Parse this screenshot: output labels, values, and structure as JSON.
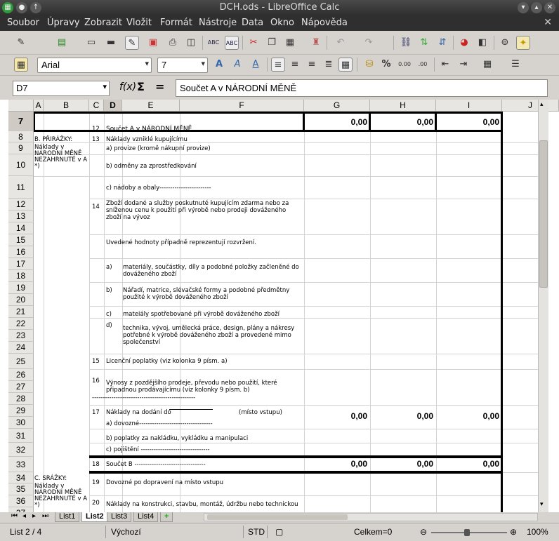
{
  "window": {
    "title": "DCH.ods - LibreOffice Calc"
  },
  "menu": [
    "Soubor",
    "Úpravy",
    "Zobrazit",
    "Vložit",
    "Formát",
    "Nástroje",
    "Data",
    "Okno",
    "Nápověda"
  ],
  "font": {
    "name": "Arial",
    "size": "7"
  },
  "cell_ref": "D7",
  "formula": "Součet A v NÁRODNÍ MĚNĚ",
  "columns": [
    "A",
    "B",
    "C",
    "D",
    "E",
    "F",
    "G",
    "H",
    "I",
    "J"
  ],
  "rows": [
    "7",
    "8",
    "9",
    "10",
    "11",
    "12",
    "13",
    "14",
    "15",
    "16",
    "17",
    "18",
    "19",
    "20",
    "21",
    "22",
    "23",
    "24",
    "25",
    "26",
    "27",
    "28",
    "29",
    "30",
    "31",
    "32",
    "33",
    "34",
    "35",
    "36",
    "37"
  ],
  "cells": {
    "r7_num": "12",
    "r7_text": "Součet A v NÁRODNÍ MĚNĚ",
    "r7_g": "0,00",
    "r7_h": "0,00",
    "r7_i": "0,00",
    "b_prirazky": "B. PŘIRÁŽKY:",
    "b_note": "Náklady v NÁRODNÍ MĚNĚ NEZAHRNUTÉ v A *)",
    "r8_num": "13",
    "r8_text": "Náklady vzniklé kupujícímu",
    "r9_text": "a) provize (kromě nákupní provize)",
    "r10_text": "b) odměny za zprostředkování",
    "r11_text": "c) nádoby a obaly------------------------",
    "r12_num": "14",
    "r12_text": "Zboží dodané a služby poskutnuté kupujícím zdarma nebo za sníženou cenu k použití při výrobě nebo prodeji dováženého zboží na vývoz",
    "r15_text": "Uvedené hodnoty případně reprezentují rozvržení.",
    "r17_a": "a)",
    "r17_text": "materiály, součástky, díly a podobné položky začleněné do dováženého zboží",
    "r19_b": "b)",
    "r19_text": "Nářadí, matrice, slévačské formy a podobné předmětny použité k výrobě dováženého zboží",
    "r21_c": "c)",
    "r21_text": "mateiály spotřebované při výrobě dováženého zboží",
    "r22_d": "d)",
    "r22_text": "technika, vývoj, umělecká práce, design, plány a nákresy potřebné k výrobě dováženého zboží a provedené mimo společenství",
    "r25_num": "15",
    "r25_text": "Licenční poplatky (viz kolonka 9 písm. a)",
    "r26_num": "16",
    "r26_text": "Výnosy z pozdějšího prodeje, převodu nebo použití, které připadnou prodávajícímu (viz kolonky 9 písm. b)",
    "r28_line": "------------------------------------------------",
    "r29_num": "17",
    "r29_text": "Náklady na dodání do",
    "r29_place": "(místo vstupu)",
    "r29_g": "0,00",
    "r29_h": "0,00",
    "r29_i": "0,00",
    "r30_text": "a) dovozné---------------------------------------",
    "r31_text": "b) poplatky za nakládku, vykládku a manipulaci",
    "r32_text": "c) pojištění --------------------------------",
    "r33_num": "18",
    "r33_text": "Součet B ---------------------------------",
    "r33_g": "0,00",
    "r33_h": "0,00",
    "r33_i": "0,00",
    "c_srazky": "C. SRÁŽKY:",
    "c_note": "Náklady v NÁRODNÍ MĚNĚ NEZAHRNUTÉ v A *)",
    "r34_num": "19",
    "r34_text": "Dovozné po dopravení na místo vstupu",
    "r36_num": "20",
    "r36_text": "Náklady na konstrukci, stavbu, montáž, údržbu nebo technickou"
  },
  "tabs": [
    "List1",
    "List2",
    "List3",
    "List4"
  ],
  "status": {
    "sheet": "List 2 / 4",
    "style": "Výchozí",
    "mode": "STD",
    "sum": "Celkem=0",
    "zoom": "100%"
  }
}
